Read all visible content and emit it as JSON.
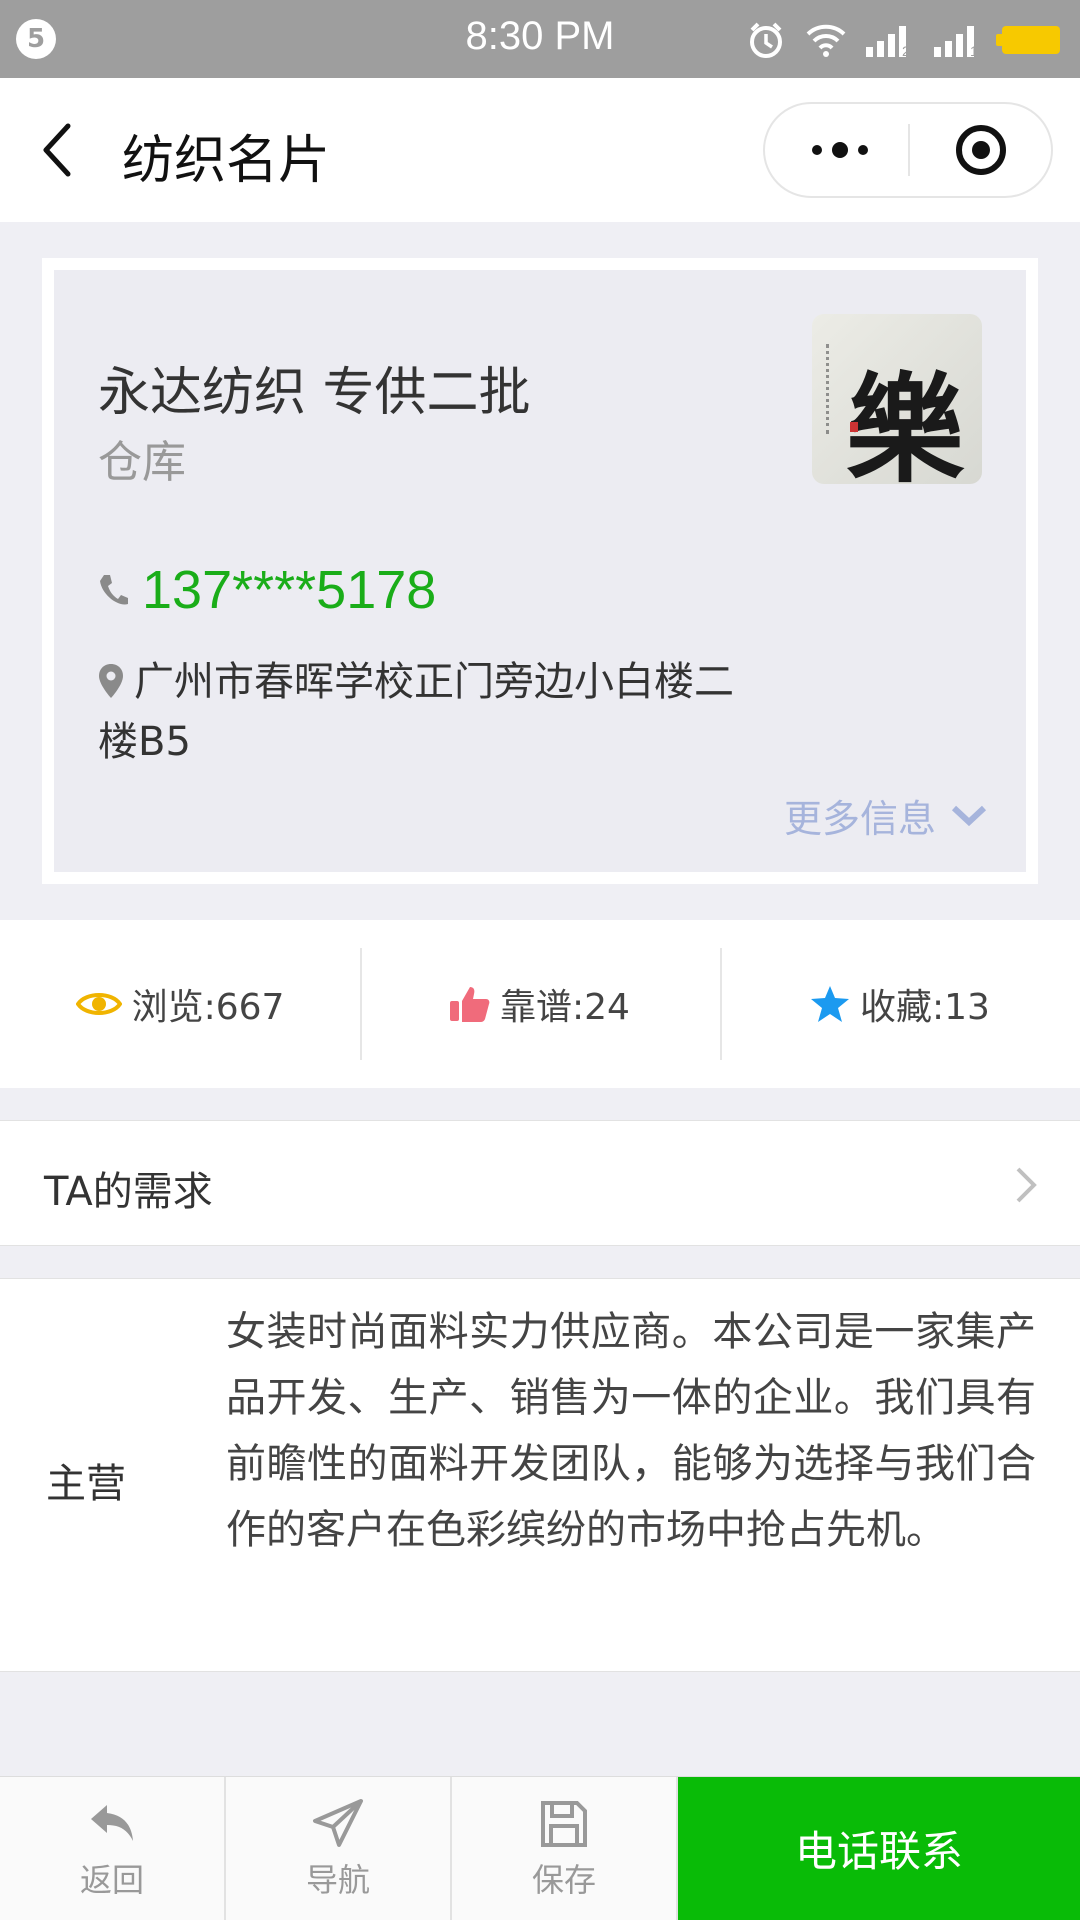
{
  "status_bar": {
    "badge": "5",
    "time": "8:30 PM"
  },
  "nav": {
    "title": "纺织名片",
    "more_icon": "more-dots-icon",
    "close_icon": "target-circle-icon"
  },
  "card": {
    "name": "永达纺织 专供二批",
    "category": "仓库",
    "phone": "137****5178",
    "address": "广州市春晖学校正门旁边小白楼二楼B5",
    "more_info": "更多信息",
    "avatar_glyph": "樂"
  },
  "stats": {
    "views": "浏览:667",
    "reliable": "靠谱:24",
    "favorites": "收藏:13"
  },
  "demand": {
    "label": "TA的需求"
  },
  "main_business": {
    "label": "主营",
    "text": "女装时尚面料实力供应商。本公司是一家集产品开发、生产、销售为一体的企业。我们具有前瞻性的面料开发团队，能够为选择与我们合作的客户在色彩缤纷的市场中抢占先机。"
  },
  "bottom_bar": {
    "back": "返回",
    "navigate": "导航",
    "save": "保存",
    "call": "电话联系"
  },
  "colors": {
    "accent_green": "#09bb07",
    "phone_green": "#1aad19",
    "more_link": "#a6b4dc",
    "eye": "#f0b400",
    "thumb": "#f06b7b",
    "star": "#1b9af0"
  }
}
